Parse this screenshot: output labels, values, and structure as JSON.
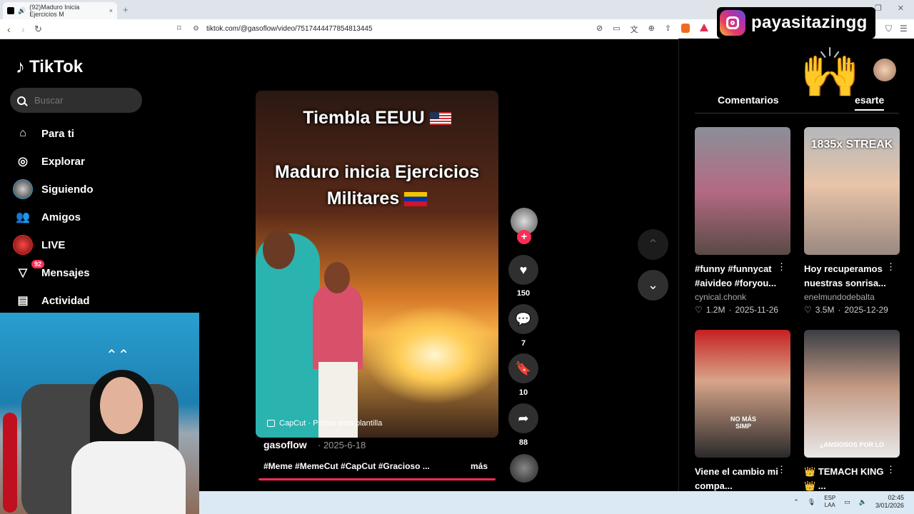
{
  "browser": {
    "tab_title": "(92)Maduro Inicia Ejercicios M",
    "tab_close": "×",
    "new_tab": "+",
    "url": "tiktok.com/@gasoflow/video/7517444477854813445",
    "window_controls": [
      "—",
      "❐",
      "✕"
    ]
  },
  "overlay": {
    "instagram_handle": "payasitazingg"
  },
  "sidebar": {
    "brand": "TikTok",
    "search_placeholder": "Buscar",
    "items": [
      {
        "label": "Para ti",
        "icon": "home-icon"
      },
      {
        "label": "Explorar",
        "icon": "compass-icon"
      },
      {
        "label": "Siguiendo",
        "icon": "avatar"
      },
      {
        "label": "Amigos",
        "icon": "people-icon"
      },
      {
        "label": "LIVE",
        "icon": "live-avatar"
      },
      {
        "label": "Mensajes",
        "icon": "inbox-icon",
        "badge": "92"
      },
      {
        "label": "Actividad",
        "icon": "activity-icon"
      }
    ]
  },
  "video": {
    "overlay_line1": "Tiembla EEUU",
    "overlay_line2": "Maduro inicia Ejercicios",
    "overlay_line3": "Militares",
    "capcut_label": "CapCut · Probar esta plantilla",
    "author": "gasoflow",
    "date": "2025-6-18",
    "hashtags": "#Meme #MemeCut #CapCut #Gracioso ...",
    "more": "más",
    "progress": 1.0
  },
  "actions": {
    "likes": "150",
    "comments": "7",
    "saves": "10",
    "shares": "88"
  },
  "right_panel": {
    "tab_comments": "Comentarios",
    "tab_explore": "Descubrirte",
    "tab_explore_visible": "esarte",
    "cards": [
      {
        "title": "#funny #funnycat #aivideo #foryou...",
        "author": "cynical.chonk",
        "likes": "1.2M",
        "date": "2025-11-26"
      },
      {
        "title": "Hoy recuperamos nuestras sonrisa...",
        "author": "enelmundodebalta",
        "likes": "3.5M",
        "date": "2025-12-29",
        "overlay": "1835x STREAK"
      },
      {
        "title": "Viene el cambio mi compa...",
        "author": "",
        "likes": "",
        "date": "",
        "overlay": "NO MÁS SIMP"
      },
      {
        "title": "👑 TEMACH KING 👑 ...",
        "author": "",
        "likes": "",
        "date": "",
        "overlay": "¿ANSIOSOS POR LO"
      }
    ]
  },
  "taskbar": {
    "lang1": "ESP",
    "lang2": "LAA",
    "time": "02:45",
    "date": "3/01/2026"
  },
  "colors": {
    "accent": "#fe2c55",
    "background": "#000000",
    "taskbar": "#dbe9f4"
  }
}
